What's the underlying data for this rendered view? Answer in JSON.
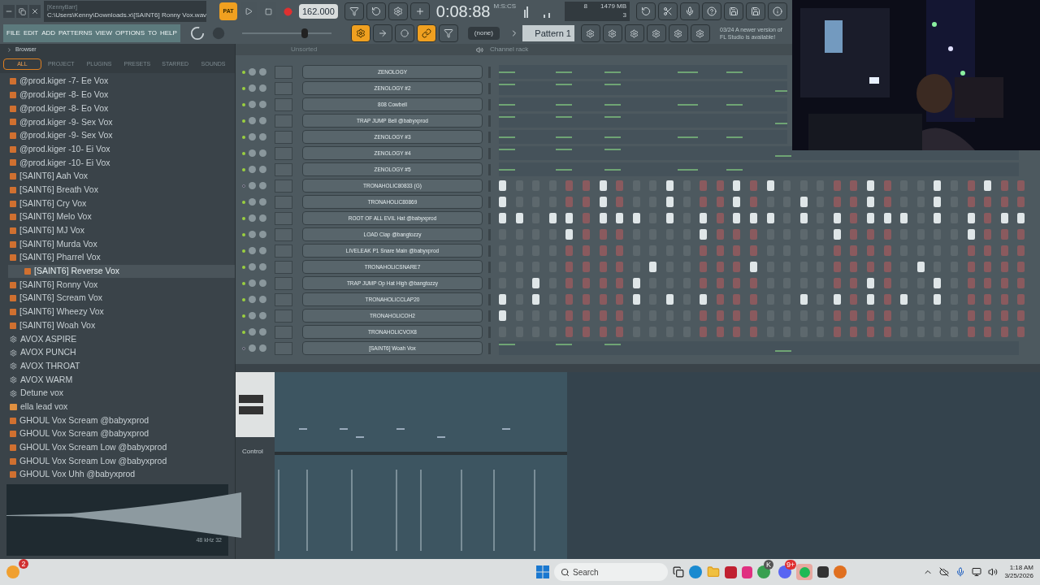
{
  "title_bar": {
    "user": "[KennyBarr]",
    "file_path": "C:\\Users\\Kenny\\Downloads.x\\[SAINT6] Ronny Vox.wav",
    "pat_label": "PAT",
    "pattern_mode": true,
    "tempo": "162.000",
    "time": "0:08:88",
    "time_unit": "M:S:CS",
    "cpu": "8",
    "memory": "1479 MB",
    "polyphony": "3"
  },
  "master_volume": {
    "level": 0.72
  },
  "menu": [
    "FILE",
    "EDIT",
    "ADD",
    "PATTERNS",
    "VIEW",
    "OPTIONS",
    "TO",
    "HELP"
  ],
  "toolbar": {
    "pattern_selector": "(none)",
    "pattern": "Pattern 1",
    "hint": [
      "03/24  A newer version of",
      "FL Studio is available!"
    ]
  },
  "browser": {
    "title": "Browser",
    "tabs": [
      {
        "label": "ALL",
        "selected": true
      },
      {
        "label": "PROJECT",
        "selected": false
      },
      {
        "label": "PLUGINS",
        "selected": false
      },
      {
        "label": "PRESETS",
        "selected": false
      },
      {
        "label": "STARRED",
        "selected": false
      },
      {
        "label": "SOUNDS",
        "selected": false
      }
    ],
    "items": [
      {
        "label": "@prod.kiger -7- Ee Vox",
        "kind": "audio",
        "selected": false
      },
      {
        "label": "@prod.kiger -8- Eo Vox",
        "kind": "audio",
        "selected": false
      },
      {
        "label": "@prod.kiger -8- Eo Vox",
        "kind": "audio",
        "selected": false
      },
      {
        "label": "@prod.kiger -9- Sex Vox",
        "kind": "audio",
        "selected": false
      },
      {
        "label": "@prod.kiger -9- Sex Vox",
        "kind": "audio",
        "selected": false
      },
      {
        "label": "@prod.kiger -10- Ei Vox",
        "kind": "audio",
        "selected": false
      },
      {
        "label": "@prod.kiger -10- Ei Vox",
        "kind": "audio",
        "selected": false
      },
      {
        "label": "[SAINT6] Aah Vox",
        "kind": "audio",
        "selected": false
      },
      {
        "label": "[SAINT6] Breath Vox",
        "kind": "audio",
        "selected": false
      },
      {
        "label": "[SAINT6] Cry Vox",
        "kind": "audio",
        "selected": false
      },
      {
        "label": "[SAINT6] Melo Vox",
        "kind": "audio",
        "selected": false
      },
      {
        "label": "[SAINT6] MJ Vox",
        "kind": "audio",
        "selected": false
      },
      {
        "label": "[SAINT6] Murda Vox",
        "kind": "audio",
        "selected": false
      },
      {
        "label": "[SAINT6] Pharrel Vox",
        "kind": "audio",
        "selected": false
      },
      {
        "label": "[SAINT6] Reverse Vox",
        "kind": "audio",
        "selected": true
      },
      {
        "label": "[SAINT6] Ronny Vox",
        "kind": "audio",
        "selected": false
      },
      {
        "label": "[SAINT6] Scream Vox",
        "kind": "audio",
        "selected": false
      },
      {
        "label": "[SAINT6] Wheezy Vox",
        "kind": "audio",
        "selected": false
      },
      {
        "label": "[SAINT6] Woah Vox",
        "kind": "audio",
        "selected": false
      },
      {
        "label": "AVOX ASPIRE",
        "kind": "preset",
        "selected": false
      },
      {
        "label": "AVOX PUNCH",
        "kind": "preset",
        "selected": false
      },
      {
        "label": "AVOX THROAT",
        "kind": "preset",
        "selected": false
      },
      {
        "label": "AVOX WARM",
        "kind": "preset",
        "selected": false
      },
      {
        "label": "Detune vox",
        "kind": "preset",
        "selected": false
      },
      {
        "label": "ella lead vox",
        "kind": "project",
        "selected": false
      },
      {
        "label": "GHOUL Vox Scream @babyxprod",
        "kind": "audio",
        "selected": false
      },
      {
        "label": "GHOUL Vox Scream @babyxprod",
        "kind": "audio",
        "selected": false
      },
      {
        "label": "GHOUL Vox Scream Low @babyxprod",
        "kind": "audio",
        "selected": false
      },
      {
        "label": "GHOUL Vox Scream Low @babyxprod",
        "kind": "audio",
        "selected": false
      },
      {
        "label": "GHOUL Vox Uhh @babyxprod",
        "kind": "audio",
        "selected": false
      }
    ],
    "sample_info": "48 kHz 32"
  },
  "channel_rack": {
    "group": "Unsorted",
    "title": "Channel rack",
    "channels": [
      {
        "name": "ZENOLOGY",
        "enabled": true,
        "kind": "preview"
      },
      {
        "name": "ZENOLOGY #2",
        "enabled": true,
        "kind": "preview"
      },
      {
        "name": "808 Cowbell",
        "enabled": true,
        "kind": "preview"
      },
      {
        "name": "TRAP JUMP Bell @babyxprod",
        "enabled": true,
        "kind": "preview"
      },
      {
        "name": "ZENOLOGY #3",
        "enabled": true,
        "kind": "preview"
      },
      {
        "name": "ZENOLOGY #4",
        "enabled": true,
        "kind": "preview"
      },
      {
        "name": "ZENOLOGY #5",
        "enabled": true,
        "kind": "preview"
      },
      {
        "name": "TRONAHOLIC80833 (G)",
        "enabled": false,
        "kind": "steps",
        "steps": [
          true,
          false,
          false,
          false,
          false,
          false,
          true,
          false,
          false,
          false,
          true,
          false,
          false,
          false,
          true,
          false,
          true,
          false,
          false,
          false,
          false,
          false,
          true,
          false,
          false,
          false,
          true,
          false,
          false,
          true,
          false,
          false
        ]
      },
      {
        "name": "TRONAHOLIC80869",
        "enabled": true,
        "kind": "steps",
        "steps": [
          true,
          false,
          false,
          false,
          false,
          false,
          true,
          false,
          false,
          false,
          true,
          false,
          false,
          false,
          true,
          false,
          false,
          false,
          true,
          false,
          false,
          false,
          true,
          false,
          false,
          false,
          true,
          false,
          false,
          false,
          false,
          false
        ]
      },
      {
        "name": "ROOT OF ALL EVIL Hat @babyxprod",
        "enabled": true,
        "kind": "steps",
        "steps": [
          true,
          true,
          false,
          true,
          true,
          false,
          true,
          true,
          true,
          false,
          true,
          false,
          true,
          false,
          true,
          true,
          true,
          false,
          true,
          false,
          true,
          false,
          true,
          true,
          true,
          false,
          true,
          false,
          true,
          false,
          true,
          true
        ]
      },
      {
        "name": "LOAD Clap @bangtozzy",
        "enabled": true,
        "kind": "steps",
        "steps": [
          false,
          false,
          false,
          false,
          true,
          false,
          false,
          false,
          false,
          false,
          false,
          false,
          true,
          false,
          false,
          false,
          false,
          false,
          false,
          false,
          true,
          false,
          false,
          false,
          false,
          false,
          false,
          false,
          true,
          false,
          false,
          false
        ]
      },
      {
        "name": "LIVELEAK P1 Snare Main @babyxprod",
        "enabled": true,
        "kind": "steps",
        "steps": [
          false,
          false,
          false,
          false,
          false,
          false,
          false,
          false,
          false,
          false,
          false,
          false,
          false,
          false,
          false,
          false,
          false,
          false,
          false,
          false,
          false,
          false,
          false,
          false,
          false,
          false,
          false,
          false,
          false,
          false,
          false,
          false
        ]
      },
      {
        "name": "TRONAHOLICSNARE7",
        "enabled": true,
        "kind": "steps",
        "steps": [
          false,
          false,
          false,
          false,
          false,
          false,
          false,
          false,
          false,
          true,
          false,
          false,
          false,
          false,
          false,
          true,
          false,
          false,
          false,
          false,
          false,
          false,
          false,
          false,
          false,
          true,
          false,
          false,
          false,
          false,
          false,
          false
        ]
      },
      {
        "name": "TRAP JUMP Op Hat High @bangtozzy",
        "enabled": true,
        "kind": "steps",
        "steps": [
          false,
          false,
          true,
          false,
          false,
          false,
          false,
          false,
          true,
          false,
          false,
          false,
          false,
          false,
          false,
          false,
          false,
          false,
          false,
          false,
          false,
          false,
          true,
          false,
          false,
          false,
          true,
          false,
          false,
          false,
          false,
          false
        ]
      },
      {
        "name": "TRONAHOLICCLAP20",
        "enabled": true,
        "kind": "steps",
        "steps": [
          true,
          false,
          true,
          false,
          false,
          false,
          false,
          false,
          true,
          false,
          true,
          false,
          true,
          false,
          false,
          false,
          false,
          false,
          true,
          false,
          true,
          false,
          true,
          false,
          true,
          false,
          true,
          false,
          false,
          false,
          false,
          false
        ]
      },
      {
        "name": "TRONAHOLICOH2",
        "enabled": true,
        "kind": "steps",
        "steps": [
          true,
          false,
          false,
          false,
          false,
          false,
          false,
          false,
          false,
          false,
          false,
          false,
          false,
          false,
          false,
          false,
          false,
          false,
          false,
          false,
          false,
          false,
          false,
          false,
          false,
          false,
          false,
          false,
          false,
          false,
          false,
          false
        ]
      },
      {
        "name": "TRONAHOLICVOX8",
        "enabled": true,
        "kind": "steps",
        "steps": [
          false,
          false,
          false,
          false,
          false,
          false,
          false,
          false,
          false,
          false,
          false,
          false,
          false,
          false,
          false,
          false,
          false,
          false,
          false,
          false,
          false,
          false,
          false,
          false,
          false,
          false,
          false,
          false,
          false,
          false,
          false,
          false
        ]
      },
      {
        "name": "[SAINT6] Woah Vox",
        "enabled": false,
        "kind": "preview"
      }
    ]
  },
  "piano_roll": {
    "control_label": "Control"
  },
  "taskbar": {
    "weather_badge": "2",
    "search_placeholder": "Search",
    "chrome_badge": "K",
    "discord_badge": "9+",
    "time": "1:18 AM",
    "date": "3/25/2026"
  }
}
